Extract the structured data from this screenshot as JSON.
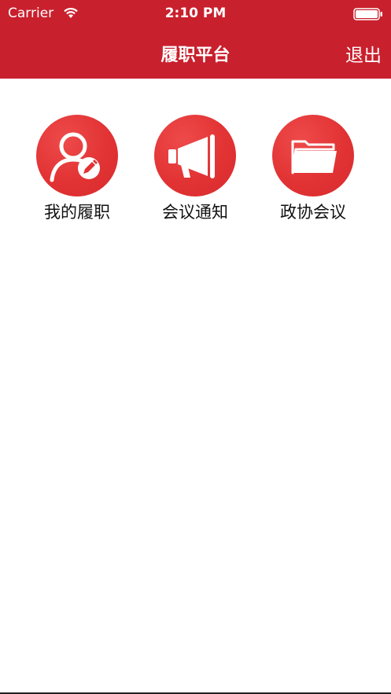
{
  "status_bar": {
    "carrier": "Carrier",
    "time": "2:10 PM"
  },
  "nav": {
    "title": "履职平台",
    "logout_label": "退出"
  },
  "menu": {
    "items": [
      {
        "label": "我的履职",
        "icon": "user-edit-icon"
      },
      {
        "label": "会议通知",
        "icon": "megaphone-icon"
      },
      {
        "label": "政协会议",
        "icon": "folder-icon"
      }
    ]
  },
  "colors": {
    "header_bg": "#c9202d",
    "icon_circle": "#e23334",
    "text": "#111111"
  }
}
